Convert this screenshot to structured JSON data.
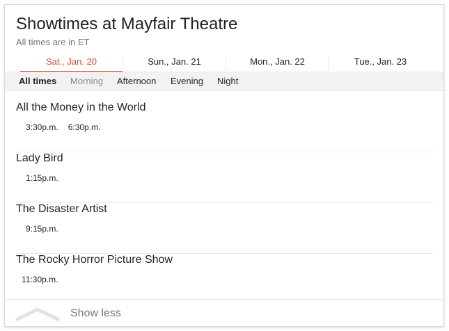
{
  "header": {
    "title": "Showtimes at Mayfair Theatre",
    "subtitle": "All times are in ET"
  },
  "dates": [
    {
      "label": "Sat., Jan. 20",
      "active": true
    },
    {
      "label": "Sun., Jan. 21",
      "active": false
    },
    {
      "label": "Mon., Jan. 22",
      "active": false
    },
    {
      "label": "Tue., Jan. 23",
      "active": false
    }
  ],
  "filters": [
    {
      "label": "All times",
      "state": "active"
    },
    {
      "label": "Morning",
      "state": "disabled"
    },
    {
      "label": "Afternoon",
      "state": "normal"
    },
    {
      "label": "Evening",
      "state": "normal"
    },
    {
      "label": "Night",
      "state": "normal"
    }
  ],
  "movies": [
    {
      "title": "All the Money in the World",
      "times": [
        "3:30p.m.",
        "6:30p.m."
      ]
    },
    {
      "title": "Lady Bird",
      "times": [
        "1:15p.m."
      ]
    },
    {
      "title": "The Disaster Artist",
      "times": [
        "9:15p.m."
      ]
    },
    {
      "title": "The Rocky Horror Picture Show",
      "times": [
        "11:30p.m."
      ]
    }
  ],
  "footer": {
    "show_less_label": "Show less",
    "icon": "chevron-up-icon"
  },
  "colors": {
    "accent": "#dd4b39",
    "muted": "#777777",
    "filter_bar_bg": "#f2f2f2"
  }
}
